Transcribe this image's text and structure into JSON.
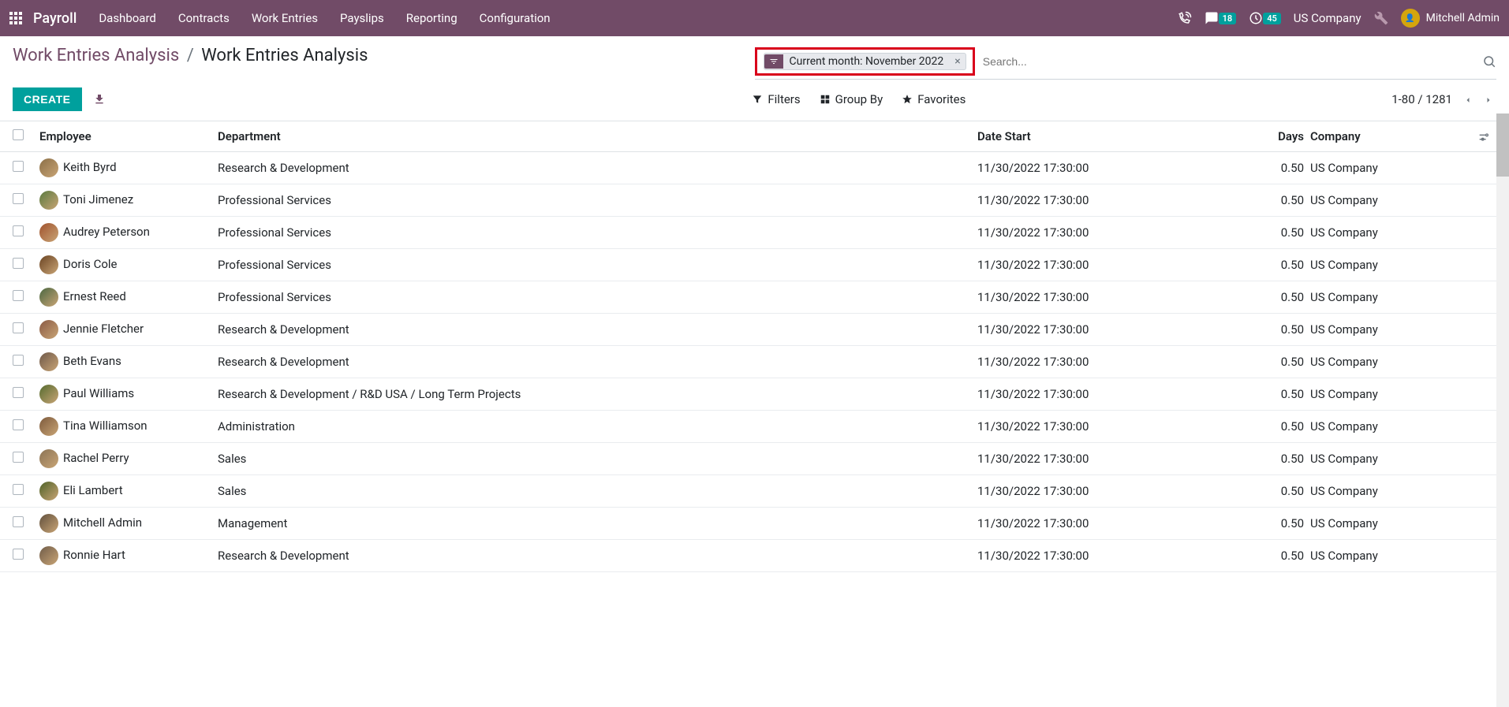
{
  "topbar": {
    "app_title": "Payroll",
    "menu": [
      "Dashboard",
      "Contracts",
      "Work Entries",
      "Payslips",
      "Reporting",
      "Configuration"
    ],
    "messages_badge": "18",
    "activities_badge": "45",
    "company": "US Company",
    "user_name": "Mitchell Admin"
  },
  "breadcrumb": {
    "parent": "Work Entries Analysis",
    "current": "Work Entries Analysis"
  },
  "search": {
    "filter_label": "Current month: November 2022",
    "placeholder": "Search..."
  },
  "buttons": {
    "create": "Create"
  },
  "search_options": {
    "filters": "Filters",
    "group_by": "Group By",
    "favorites": "Favorites"
  },
  "pager": {
    "range": "1-80 / 1281"
  },
  "table": {
    "headers": {
      "employee": "Employee",
      "department": "Department",
      "date_start": "Date Start",
      "days": "Days",
      "company": "Company"
    },
    "rows": [
      {
        "employee": "Keith Byrd",
        "department": "Research & Development",
        "date_start": "11/30/2022 17:30:00",
        "days": "0.50",
        "company": "US Company"
      },
      {
        "employee": "Toni Jimenez",
        "department": "Professional Services",
        "date_start": "11/30/2022 17:30:00",
        "days": "0.50",
        "company": "US Company"
      },
      {
        "employee": "Audrey Peterson",
        "department": "Professional Services",
        "date_start": "11/30/2022 17:30:00",
        "days": "0.50",
        "company": "US Company"
      },
      {
        "employee": "Doris Cole",
        "department": "Professional Services",
        "date_start": "11/30/2022 17:30:00",
        "days": "0.50",
        "company": "US Company"
      },
      {
        "employee": "Ernest Reed",
        "department": "Professional Services",
        "date_start": "11/30/2022 17:30:00",
        "days": "0.50",
        "company": "US Company"
      },
      {
        "employee": "Jennie Fletcher",
        "department": "Research & Development",
        "date_start": "11/30/2022 17:30:00",
        "days": "0.50",
        "company": "US Company"
      },
      {
        "employee": "Beth Evans",
        "department": "Research & Development",
        "date_start": "11/30/2022 17:30:00",
        "days": "0.50",
        "company": "US Company"
      },
      {
        "employee": "Paul Williams",
        "department": "Research & Development / R&D USA / Long Term Projects",
        "date_start": "11/30/2022 17:30:00",
        "days": "0.50",
        "company": "US Company"
      },
      {
        "employee": "Tina Williamson",
        "department": "Administration",
        "date_start": "11/30/2022 17:30:00",
        "days": "0.50",
        "company": "US Company"
      },
      {
        "employee": "Rachel Perry",
        "department": "Sales",
        "date_start": "11/30/2022 17:30:00",
        "days": "0.50",
        "company": "US Company"
      },
      {
        "employee": "Eli Lambert",
        "department": "Sales",
        "date_start": "11/30/2022 17:30:00",
        "days": "0.50",
        "company": "US Company"
      },
      {
        "employee": "Mitchell Admin",
        "department": "Management",
        "date_start": "11/30/2022 17:30:00",
        "days": "0.50",
        "company": "US Company"
      },
      {
        "employee": "Ronnie Hart",
        "department": "Research & Development",
        "date_start": "11/30/2022 17:30:00",
        "days": "0.50",
        "company": "US Company"
      }
    ]
  }
}
